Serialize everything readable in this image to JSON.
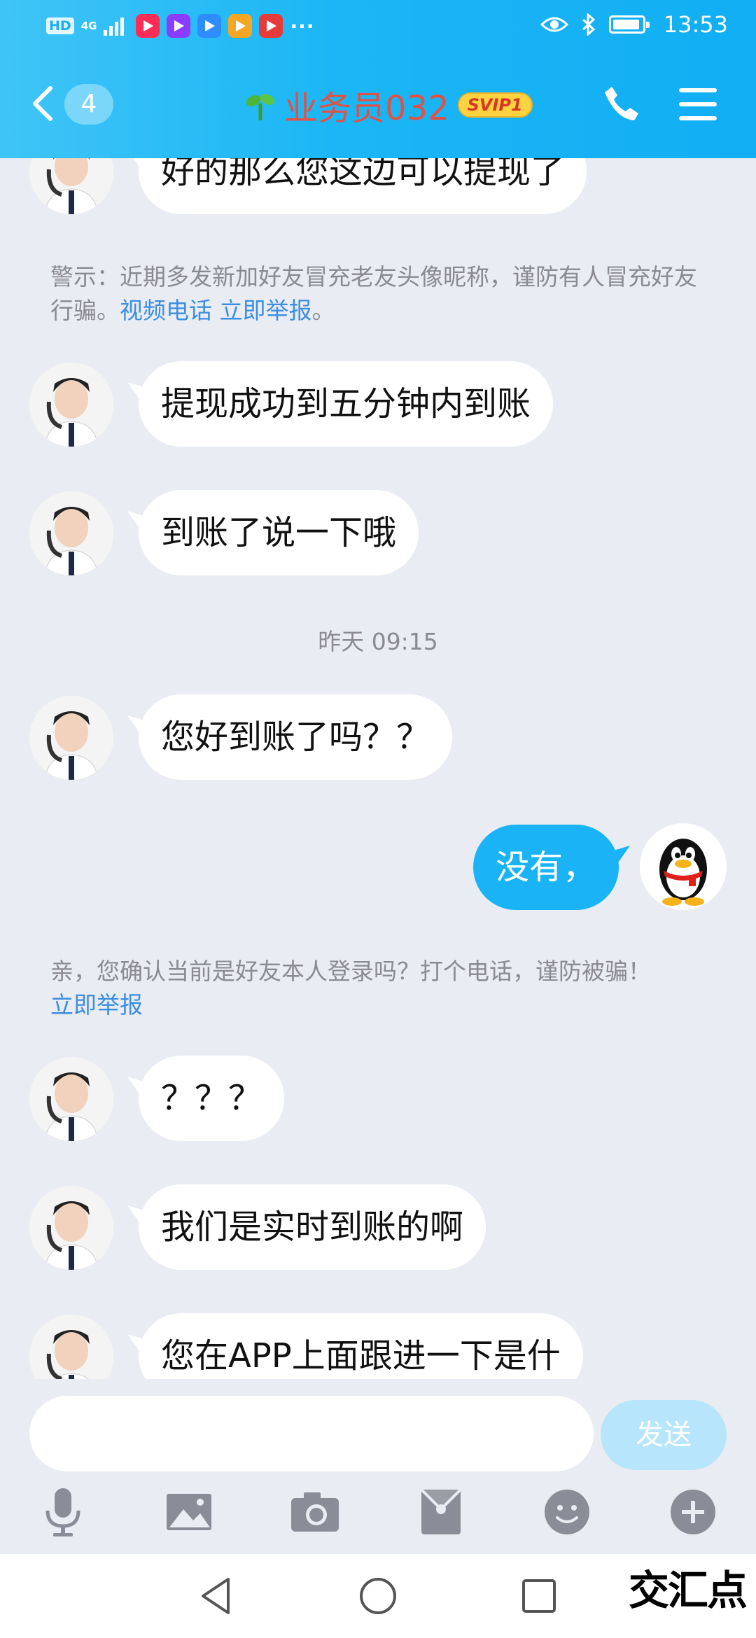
{
  "status_bar": {
    "hd_tag": "HD",
    "network": "4G",
    "more": "···",
    "time": "13:53"
  },
  "header": {
    "back_count": "4",
    "title": "业务员032",
    "badge": "SVIP1"
  },
  "colors": {
    "header_blue": "#1ab6f5",
    "my_bubble": "#1ab3f5",
    "link_blue": "#3b8ee0",
    "title_red": "#e05245"
  },
  "chat": {
    "messages": [
      {
        "text": "好的那么您这边可以提现了"
      },
      {
        "text": "提现成功到五分钟内到账"
      },
      {
        "text": "到账了说一下哦"
      },
      {
        "text": "您好到账了吗？？"
      },
      {
        "text": "没有，"
      },
      {
        "text": "？？？"
      },
      {
        "text": "我们是实时到账的啊"
      },
      {
        "text": "您在APP上面跟进一下是什"
      }
    ],
    "warning1": {
      "text": "警示：近期多发新加好友冒充老友头像昵称，谨防有人冒充好友行骗。",
      "link1": "视频电话",
      "link2": "立即举报",
      "suffix": "。"
    },
    "timestamp": "昨天 09:15",
    "warning2": {
      "text": "亲，您确认当前是好友本人登录吗？打个电话，谨防被骗！",
      "link": "立即举报"
    }
  },
  "input": {
    "placeholder": "",
    "send_label": "发送"
  },
  "toolbar_icons": [
    "microphone-icon",
    "image-icon",
    "camera-icon",
    "red-packet-icon",
    "emoji-icon",
    "plus-icon"
  ],
  "watermark": "交汇点"
}
